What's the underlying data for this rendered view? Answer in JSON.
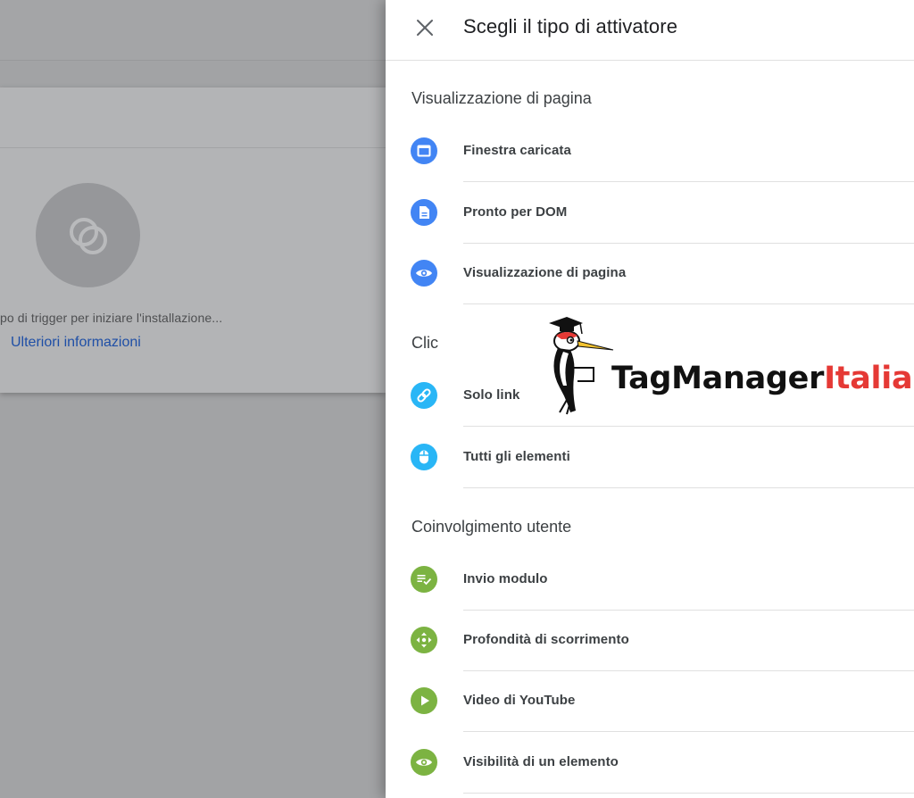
{
  "background": {
    "hint_text": "po di trigger per iniziare l'installazione...",
    "link_text": "Ulteriori informazioni"
  },
  "panel": {
    "title": "Scegli il tipo di attivatore",
    "sections": [
      {
        "title": "Visualizzazione di pagina",
        "items": [
          {
            "label": "Finestra caricata",
            "icon": "window-icon",
            "color": "#4285f4"
          },
          {
            "label": "Pronto per DOM",
            "icon": "document-icon",
            "color": "#4285f4"
          },
          {
            "label": "Visualizzazione di pagina",
            "icon": "eye-icon",
            "color": "#4285f4"
          }
        ]
      },
      {
        "title": "Clic",
        "items": [
          {
            "label": "Solo link",
            "icon": "link-icon",
            "color": "#29b6f6"
          },
          {
            "label": "Tutti gli elementi",
            "icon": "mouse-icon",
            "color": "#29b6f6"
          }
        ]
      },
      {
        "title": "Coinvolgimento utente",
        "items": [
          {
            "label": "Invio modulo",
            "icon": "form-check-icon",
            "color": "#7cb342"
          },
          {
            "label": "Profondità di scorrimento",
            "icon": "scroll-arrows-icon",
            "color": "#7cb342"
          },
          {
            "label": "Video di YouTube",
            "icon": "play-icon",
            "color": "#7cb342"
          },
          {
            "label": "Visibilità di un elemento",
            "icon": "eye-icon",
            "color": "#7cb342"
          }
        ]
      }
    ]
  },
  "logo": {
    "part1": "TagManager",
    "part2": "Italia",
    "color_dark": "#111111",
    "color_accent": "#e53935"
  }
}
